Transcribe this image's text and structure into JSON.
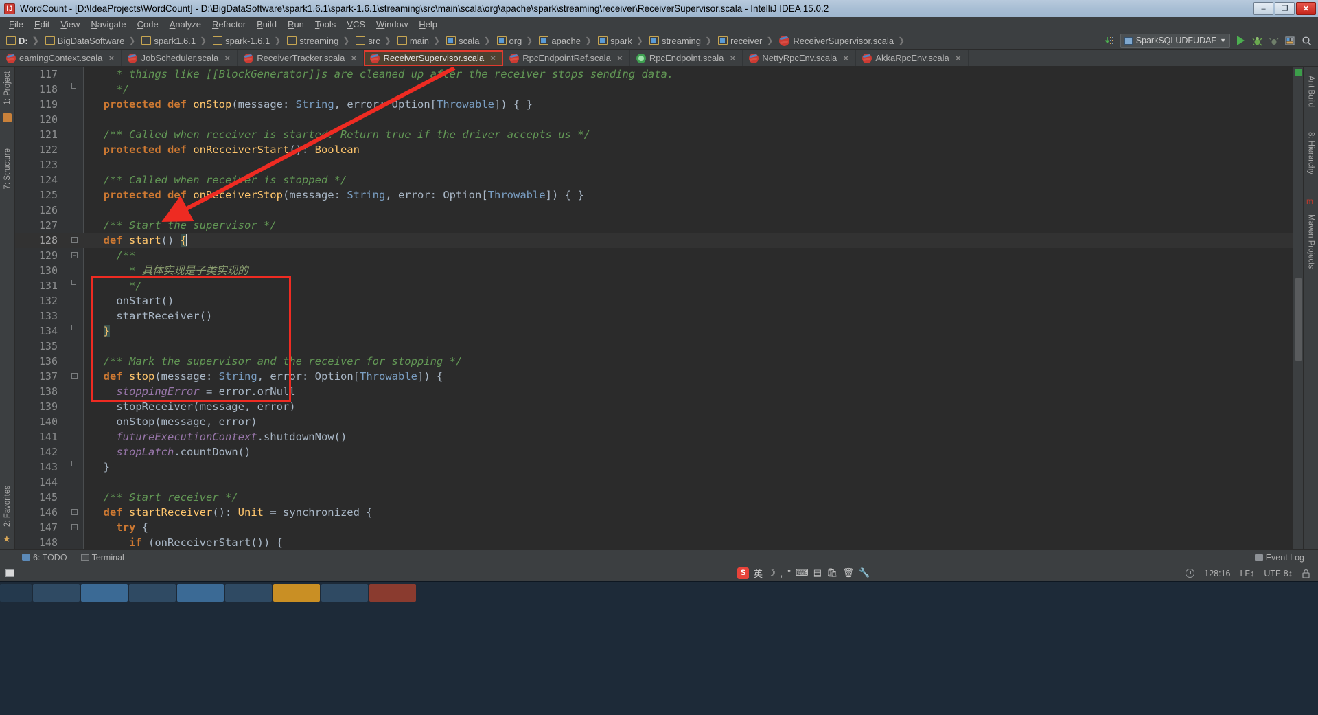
{
  "window": {
    "title": "WordCount - [D:\\IdeaProjects\\WordCount] - D:\\BigDataSoftware\\spark1.6.1\\spark-1.6.1\\streaming\\src\\main\\scala\\org\\apache\\spark\\streaming\\receiver\\ReceiverSupervisor.scala - IntelliJ IDEA 15.0.2",
    "app_icon": "intellij-idea-icon",
    "minimize_label": "–",
    "maximize_label": "❐",
    "close_label": "✕"
  },
  "menubar": {
    "items": [
      {
        "label": "File"
      },
      {
        "label": "Edit"
      },
      {
        "label": "View"
      },
      {
        "label": "Navigate"
      },
      {
        "label": "Code"
      },
      {
        "label": "Analyze"
      },
      {
        "label": "Refactor"
      },
      {
        "label": "Build"
      },
      {
        "label": "Run"
      },
      {
        "label": "Tools"
      },
      {
        "label": "VCS"
      },
      {
        "label": "Window"
      },
      {
        "label": "Help"
      }
    ]
  },
  "navbar": {
    "breadcrumbs": [
      {
        "label": "D:",
        "icon": "folder-icon",
        "bold": true
      },
      {
        "label": "BigDataSoftware",
        "icon": "folder-icon"
      },
      {
        "label": "spark1.6.1",
        "icon": "folder-icon"
      },
      {
        "label": "spark-1.6.1",
        "icon": "folder-icon"
      },
      {
        "label": "streaming",
        "icon": "folder-icon"
      },
      {
        "label": "src",
        "icon": "folder-icon"
      },
      {
        "label": "main",
        "icon": "folder-icon"
      },
      {
        "label": "scala",
        "icon": "source-folder-icon"
      },
      {
        "label": "org",
        "icon": "source-folder-icon"
      },
      {
        "label": "apache",
        "icon": "source-folder-icon"
      },
      {
        "label": "spark",
        "icon": "source-folder-icon"
      },
      {
        "label": "streaming",
        "icon": "source-folder-icon"
      },
      {
        "label": "receiver",
        "icon": "source-folder-icon"
      },
      {
        "label": "ReceiverSupervisor.scala",
        "icon": "scala-class-icon"
      }
    ],
    "run_configuration": "SparkSQLUDFUDAF",
    "run_config_dropdown": "▼",
    "buttons": [
      {
        "name": "update-project-icon",
        "glyph": "⬇"
      },
      {
        "name": "run-button",
        "glyph": "▶"
      },
      {
        "name": "debug-button",
        "glyph": "🐞"
      },
      {
        "name": "run-coverage-button",
        "glyph": "▶"
      },
      {
        "name": "layout-button",
        "glyph": "▦"
      },
      {
        "name": "search-everywhere-icon",
        "glyph": "🔍"
      }
    ]
  },
  "tabs": [
    {
      "label": "eamingContext.scala",
      "icon": "scala-class-icon",
      "active": false,
      "truncated": true
    },
    {
      "label": "JobScheduler.scala",
      "icon": "scala-class-icon",
      "active": false
    },
    {
      "label": "ReceiverTracker.scala",
      "icon": "scala-class-icon",
      "active": false
    },
    {
      "label": "ReceiverSupervisor.scala",
      "icon": "scala-class-icon",
      "active": true,
      "highlighted": true
    },
    {
      "label": "RpcEndpointRef.scala",
      "icon": "scala-class-icon",
      "active": false
    },
    {
      "label": "RpcEndpoint.scala",
      "icon": "scala-trait-icon",
      "active": false
    },
    {
      "label": "NettyRpcEnv.scala",
      "icon": "scala-class-icon",
      "active": false
    },
    {
      "label": "AkkaRpcEnv.scala",
      "icon": "scala-class-icon",
      "active": false
    }
  ],
  "left_strip": [
    {
      "label": "1: Project",
      "name": "tool-window-project"
    },
    {
      "label": "7: Structure",
      "name": "tool-window-structure"
    },
    {
      "label": "2: Favorites",
      "name": "tool-window-favorites"
    }
  ],
  "right_strip": [
    {
      "label": "Ant Build",
      "name": "tool-window-ant-build"
    },
    {
      "label": "8: Hierarchy",
      "name": "tool-window-hierarchy"
    },
    {
      "label": "Maven Projects",
      "name": "tool-window-maven-projects"
    }
  ],
  "editor": {
    "first_line": 117,
    "current_line": 128,
    "lines": [
      {
        "n": 117,
        "segments": [
          {
            "t": "    * things like [[BlockGenerator]]s are cleaned up after the receiver stops sending data.",
            "c": "cmt"
          }
        ]
      },
      {
        "n": 118,
        "fold": "end",
        "segments": [
          {
            "t": "    */",
            "c": "cmt"
          }
        ]
      },
      {
        "n": 119,
        "segments": [
          {
            "t": "  ",
            "c": "plain"
          },
          {
            "t": "protected def ",
            "c": "kw"
          },
          {
            "t": "onStop",
            "c": "fn"
          },
          {
            "t": "(message: ",
            "c": "plain"
          },
          {
            "t": "String",
            "c": "typ"
          },
          {
            "t": ", error: ",
            "c": "plain"
          },
          {
            "t": "Option",
            "c": "plain"
          },
          {
            "t": "[",
            "c": "plain"
          },
          {
            "t": "Throwable",
            "c": "typ"
          },
          {
            "t": "]) { }",
            "c": "plain"
          }
        ]
      },
      {
        "n": 120,
        "segments": []
      },
      {
        "n": 121,
        "segments": [
          {
            "t": "  /** Called when receiver is started. Return true if the driver accepts us */",
            "c": "cmt"
          }
        ]
      },
      {
        "n": 122,
        "segments": [
          {
            "t": "  ",
            "c": "plain"
          },
          {
            "t": "protected def ",
            "c": "kw"
          },
          {
            "t": "onReceiverStart",
            "c": "fn"
          },
          {
            "t": "(): ",
            "c": "plain"
          },
          {
            "t": "Boolean",
            "c": "fn"
          }
        ]
      },
      {
        "n": 123,
        "segments": []
      },
      {
        "n": 124,
        "segments": [
          {
            "t": "  /** Called when receiver is stopped */",
            "c": "cmt"
          }
        ]
      },
      {
        "n": 125,
        "segments": [
          {
            "t": "  ",
            "c": "plain"
          },
          {
            "t": "protected def ",
            "c": "kw"
          },
          {
            "t": "onReceiverStop",
            "c": "fn"
          },
          {
            "t": "(message: ",
            "c": "plain"
          },
          {
            "t": "String",
            "c": "typ"
          },
          {
            "t": ", error: ",
            "c": "plain"
          },
          {
            "t": "Option",
            "c": "plain"
          },
          {
            "t": "[",
            "c": "plain"
          },
          {
            "t": "Throwable",
            "c": "typ"
          },
          {
            "t": "]) { }",
            "c": "plain"
          }
        ]
      },
      {
        "n": 126,
        "segments": []
      },
      {
        "n": 127,
        "segments": [
          {
            "t": "  /** Start the supervisor */",
            "c": "cmt"
          }
        ]
      },
      {
        "n": 128,
        "current": true,
        "fold": "open",
        "segments": [
          {
            "t": "  ",
            "c": "plain"
          },
          {
            "t": "def ",
            "c": "kw"
          },
          {
            "t": "start",
            "c": "fn"
          },
          {
            "t": "() ",
            "c": "plain"
          },
          {
            "t": "{",
            "c": "brace"
          }
        ],
        "caret": true
      },
      {
        "n": 129,
        "fold": "open",
        "segments": [
          {
            "t": "    /**",
            "c": "cmt"
          }
        ]
      },
      {
        "n": 130,
        "segments": [
          {
            "t": "      * ",
            "c": "cmt"
          },
          {
            "t": "具体实现是子类实现的",
            "c": "cmtzh"
          }
        ]
      },
      {
        "n": 131,
        "fold": "end",
        "segments": [
          {
            "t": "      */",
            "c": "cmt"
          }
        ]
      },
      {
        "n": 132,
        "segments": [
          {
            "t": "    ",
            "c": "plain"
          },
          {
            "t": "onStart()",
            "c": "plain"
          }
        ]
      },
      {
        "n": 133,
        "segments": [
          {
            "t": "    ",
            "c": "plain"
          },
          {
            "t": "startReceiver()",
            "c": "plain"
          }
        ]
      },
      {
        "n": 134,
        "fold": "end",
        "segments": [
          {
            "t": "  ",
            "c": "plain"
          },
          {
            "t": "}",
            "c": "brace"
          }
        ]
      },
      {
        "n": 135,
        "segments": []
      },
      {
        "n": 136,
        "segments": [
          {
            "t": "  /** Mark the supervisor and the receiver for stopping */",
            "c": "cmt"
          }
        ]
      },
      {
        "n": 137,
        "fold": "open",
        "segments": [
          {
            "t": "  ",
            "c": "plain"
          },
          {
            "t": "def ",
            "c": "kw"
          },
          {
            "t": "stop",
            "c": "fn"
          },
          {
            "t": "(message: ",
            "c": "plain"
          },
          {
            "t": "String",
            "c": "typ"
          },
          {
            "t": ", error: ",
            "c": "plain"
          },
          {
            "t": "Option",
            "c": "plain"
          },
          {
            "t": "[",
            "c": "plain"
          },
          {
            "t": "Throwable",
            "c": "typ"
          },
          {
            "t": "]) {",
            "c": "plain"
          }
        ]
      },
      {
        "n": 138,
        "segments": [
          {
            "t": "    ",
            "c": "plain"
          },
          {
            "t": "stoppingError",
            "c": "fld"
          },
          {
            "t": " = error.orNull",
            "c": "plain"
          }
        ]
      },
      {
        "n": 139,
        "segments": [
          {
            "t": "    stopReceiver(message, error)",
            "c": "plain"
          }
        ]
      },
      {
        "n": 140,
        "segments": [
          {
            "t": "    onStop(message, error)",
            "c": "plain"
          }
        ]
      },
      {
        "n": 141,
        "segments": [
          {
            "t": "    ",
            "c": "plain"
          },
          {
            "t": "futureExecutionContext",
            "c": "fld"
          },
          {
            "t": ".shutdownNow()",
            "c": "plain"
          }
        ]
      },
      {
        "n": 142,
        "segments": [
          {
            "t": "    ",
            "c": "plain"
          },
          {
            "t": "stopLatch",
            "c": "fld"
          },
          {
            "t": ".countDown()",
            "c": "plain"
          }
        ]
      },
      {
        "n": 143,
        "fold": "end",
        "segments": [
          {
            "t": "  }",
            "c": "plain"
          }
        ]
      },
      {
        "n": 144,
        "segments": []
      },
      {
        "n": 145,
        "segments": [
          {
            "t": "  /** Start receiver */",
            "c": "cmt"
          }
        ]
      },
      {
        "n": 146,
        "fold": "open",
        "segments": [
          {
            "t": "  ",
            "c": "plain"
          },
          {
            "t": "def ",
            "c": "kw"
          },
          {
            "t": "startReceiver",
            "c": "fn"
          },
          {
            "t": "(): ",
            "c": "plain"
          },
          {
            "t": "Unit",
            "c": "fn"
          },
          {
            "t": " = ",
            "c": "plain"
          },
          {
            "t": "synchronized",
            "c": "plain"
          },
          {
            "t": " {",
            "c": "plain"
          }
        ]
      },
      {
        "n": 147,
        "fold": "open",
        "segments": [
          {
            "t": "    ",
            "c": "plain"
          },
          {
            "t": "try",
            "c": "kw"
          },
          {
            "t": " {",
            "c": "plain"
          }
        ]
      },
      {
        "n": 148,
        "segments": [
          {
            "t": "      ",
            "c": "plain"
          },
          {
            "t": "if",
            "c": "kw"
          },
          {
            "t": " (onReceiverStart()) {",
            "c": "plain"
          }
        ]
      }
    ],
    "annotation": {
      "type": "red-rectangle-and-arrow",
      "color": "#ee2b22",
      "covers_lines": "127-134"
    }
  },
  "bottombar": {
    "todo_label": "6: TODO",
    "terminal_label": "Terminal",
    "event_log_label": "Event Log"
  },
  "statusbar": {
    "caret_position": "128:16",
    "line_separator": "LF↕",
    "encoding": "UTF-8↕",
    "lock_icon": "lock-icon"
  },
  "ime": {
    "logo_text": "S",
    "mode_label": "英",
    "icons": [
      "moon-icon",
      "comma-icon",
      "keyboard-icon",
      "toolbox-icon",
      "bag-icon",
      "trash-icon",
      "wrench-icon"
    ]
  },
  "colors": {
    "titlebar_start": "#b8cadd",
    "editor_bg": "#2b2b2b",
    "chrome_bg": "#3c3f41",
    "gutter_bg": "#313335",
    "accent_red": "#ee2b22",
    "comment_green": "#629755",
    "keyword_orange": "#cc7832",
    "method_yellow": "#ffc66d",
    "type_blue": "#7a9ec2",
    "field_purple": "#9876aa",
    "active_tab_bg": "#4e4130",
    "taskbar_bg": "#1d2a38"
  }
}
